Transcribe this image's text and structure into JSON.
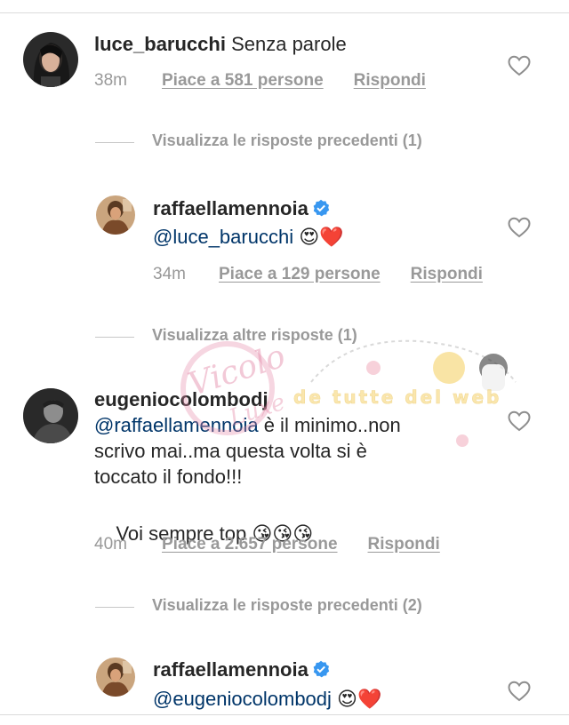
{
  "comments": [
    {
      "username": "luce_barucchi",
      "text": "Senza parole",
      "time": "38m",
      "likes": "Piace a 581 persone",
      "reply": "Rispondi"
    },
    {
      "view_replies": "Visualizza le risposte precedenti (1)"
    },
    {
      "username": "raffaellamennoia",
      "mention": "@luce_barucchi",
      "emoji": "😍❤️",
      "time": "34m",
      "likes": "Piace a 129 persone",
      "reply": "Rispondi"
    },
    {
      "view_replies": "Visualizza altre risposte (1)"
    },
    {
      "username": "eugeniocolombodj",
      "mention": "@raffaellamennoia",
      "text_line1": " è il minimo..non",
      "text_line2": "scrivo mai..ma questa volta si è",
      "text_line3": "toccato il fondo!!!",
      "text_line4": "Voi sempre top ",
      "emoji": "😘😘😘",
      "time": "40m",
      "likes": "Piace a 2.657 persone",
      "reply": "Rispondi"
    },
    {
      "view_replies": "Visualizza le risposte precedenti (2)"
    },
    {
      "username": "raffaellamennoia",
      "mention": "@eugeniocolombodj",
      "emoji": "😍❤️"
    }
  ],
  "colors": {
    "mention": "#003569",
    "verified": "#3897f0",
    "muted": "#999999"
  },
  "icons": [
    "heart-outline-icon",
    "verified-badge-icon"
  ],
  "watermark": {
    "stamp_text": "Vicolo",
    "stamp_text2": "Luxe",
    "banner_text": "de tutte del web"
  }
}
